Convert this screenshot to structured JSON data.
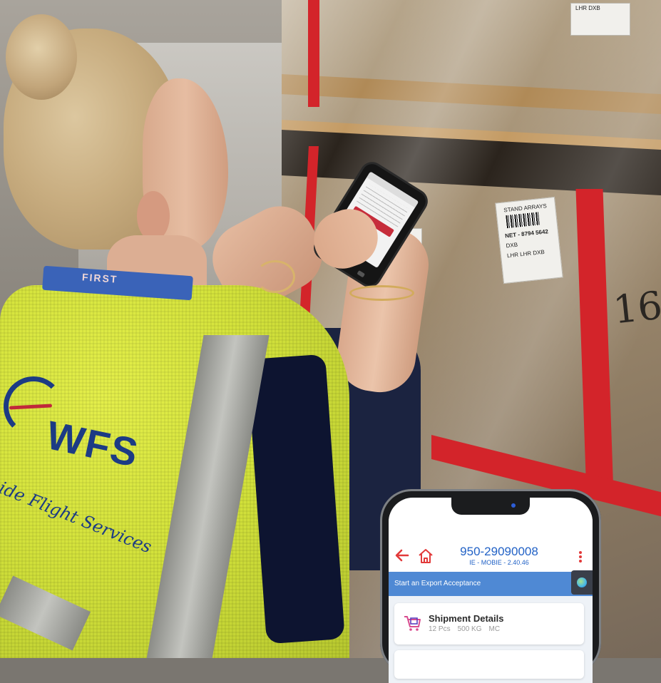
{
  "scene": {
    "vest_logo": "WFS",
    "vest_tagline": "ide Flight Services",
    "lanyard_text": "FIRST",
    "box_handwriting": "16",
    "label_lines": [
      "STAND ARRAYS",
      "NET - 8794 5642",
      "DXB",
      "LHR  LHR  DXB"
    ],
    "top_label_line": "LHR  DXB"
  },
  "phone_app": {
    "header": {
      "awb_number": "950-29090008",
      "version": "IE - MOBIE - 2.40.46",
      "back_icon": "arrow-left-icon",
      "home_icon": "home-icon",
      "menu_icon": "more-vertical-icon"
    },
    "section_title": "Start an Export Acceptance",
    "shipment_card": {
      "title": "Shipment Details",
      "pieces": "12 Pcs",
      "weight": "500 KG",
      "code": "MC",
      "icon": "cart-icon"
    },
    "colors": {
      "accent_blue": "#2262c6",
      "section_blue": "#4f89d4",
      "icon_red": "#e23a3a"
    }
  }
}
